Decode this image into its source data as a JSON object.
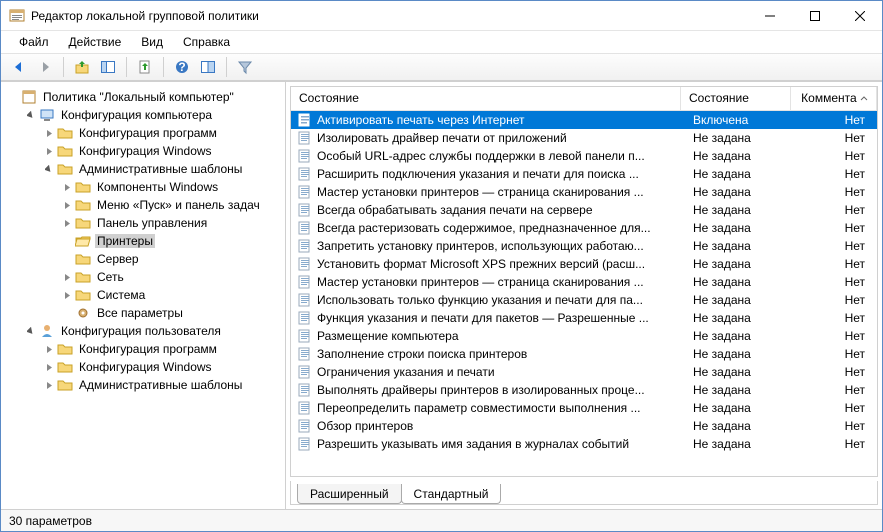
{
  "window": {
    "title": "Редактор локальной групповой политики"
  },
  "menu": {
    "file": "Файл",
    "action": "Действие",
    "view": "Вид",
    "help": "Справка"
  },
  "tree": {
    "root": "Политика \"Локальный компьютер\"",
    "comp": "Конфигурация компьютера",
    "comp_soft": "Конфигурация программ",
    "comp_win": "Конфигурация Windows",
    "comp_adm": "Административные шаблоны",
    "adm_components": "Компоненты Windows",
    "adm_startmenu": "Меню «Пуск» и панель задач",
    "adm_control": "Панель управления",
    "adm_printers": "Принтеры",
    "adm_server": "Сервер",
    "adm_network": "Сеть",
    "adm_system": "Система",
    "adm_all": "Все параметры",
    "user": "Конфигурация пользователя",
    "user_soft": "Конфигурация программ",
    "user_win": "Конфигурация Windows",
    "user_adm": "Административные шаблоны"
  },
  "columns": {
    "state_title": "Состояние",
    "state": "Состояние",
    "comment": "Коммента"
  },
  "states": {
    "enabled": "Включена",
    "notset": "Не задана"
  },
  "comment_no": "Нет",
  "rows": [
    {
      "name": "Активировать печать через Интернет",
      "state": "enabled",
      "sel": true
    },
    {
      "name": "Изолировать драйвер печати от приложений",
      "state": "notset"
    },
    {
      "name": "Особый URL-адрес службы поддержки в левой панели п...",
      "state": "notset"
    },
    {
      "name": "Расширить подключения указания и печати для поиска ...",
      "state": "notset"
    },
    {
      "name": "Мастер установки принтеров — страница сканирования ...",
      "state": "notset"
    },
    {
      "name": "Всегда обрабатывать задания печати на сервере",
      "state": "notset"
    },
    {
      "name": "Всегда растеризовать содержимое, предназначенное для...",
      "state": "notset"
    },
    {
      "name": "Запретить установку принтеров, использующих работаю...",
      "state": "notset"
    },
    {
      "name": "Установить формат Microsoft XPS прежних версий (расш...",
      "state": "notset"
    },
    {
      "name": "Мастер установки принтеров — страница сканирования ...",
      "state": "notset"
    },
    {
      "name": "Использовать только функцию указания и печати для па...",
      "state": "notset"
    },
    {
      "name": "Функция указания и печати для пакетов — Разрешенные ...",
      "state": "notset"
    },
    {
      "name": "Размещение компьютера",
      "state": "notset"
    },
    {
      "name": "Заполнение строки поиска принтеров",
      "state": "notset"
    },
    {
      "name": "Ограничения указания и печати",
      "state": "notset"
    },
    {
      "name": "Выполнять драйверы принтеров в изолированных проце...",
      "state": "notset"
    },
    {
      "name": "Переопределить параметр совместимости выполнения ...",
      "state": "notset"
    },
    {
      "name": "Обзор принтеров",
      "state": "notset"
    },
    {
      "name": "Разрешить указывать имя задания в журналах событий",
      "state": "notset"
    }
  ],
  "tabs": {
    "extended": "Расширенный",
    "standard": "Стандартный"
  },
  "status": "30 параметров"
}
